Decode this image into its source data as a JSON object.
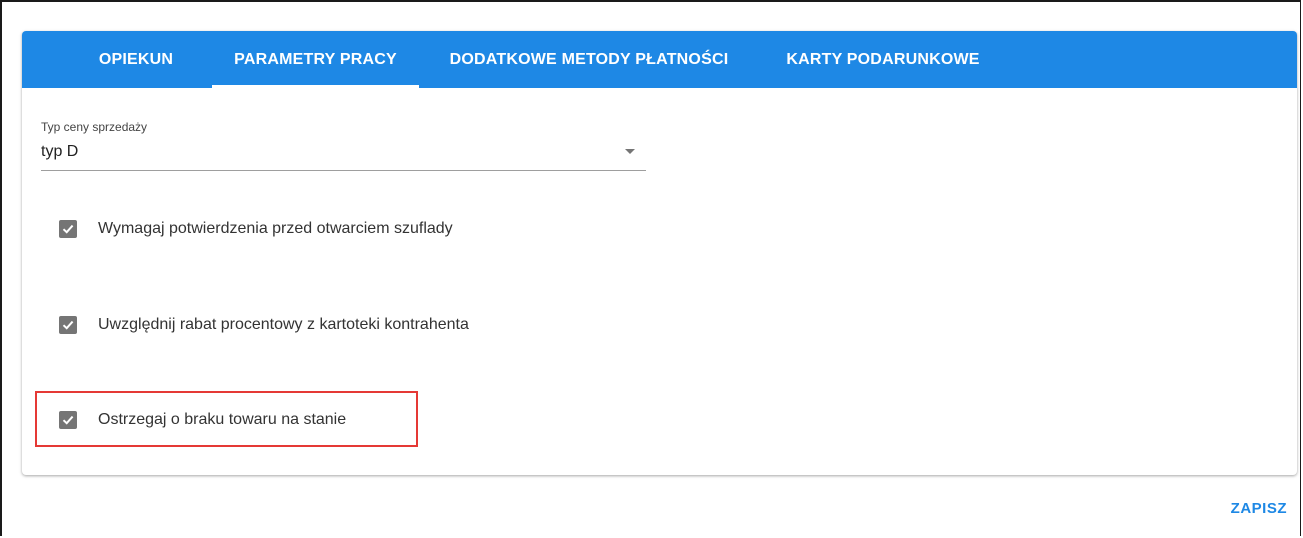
{
  "tabs": [
    {
      "label": "OPIEKUN",
      "active": false
    },
    {
      "label": "PARAMETRY PRACY",
      "active": true
    },
    {
      "label": "DODATKOWE METODY PŁATNOŚCI",
      "active": false
    },
    {
      "label": "KARTY PODARUNKOWE",
      "active": false
    }
  ],
  "price_type": {
    "label": "Typ ceny sprzedaży",
    "value": "typ D"
  },
  "options": [
    {
      "label": "Wymagaj potwierdzenia przed otwarciem szuflady",
      "checked": true
    },
    {
      "label": "Uwzględnij rabat procentowy z kartoteki kontrahenta",
      "checked": true
    },
    {
      "label": "Ostrzegaj o braku towaru na stanie",
      "checked": true,
      "highlighted": true
    }
  ],
  "actions": {
    "save_label": "ZAPISZ"
  },
  "colors": {
    "primary": "#1e88e5",
    "highlight": "#e53935",
    "checkbox": "#757575"
  }
}
